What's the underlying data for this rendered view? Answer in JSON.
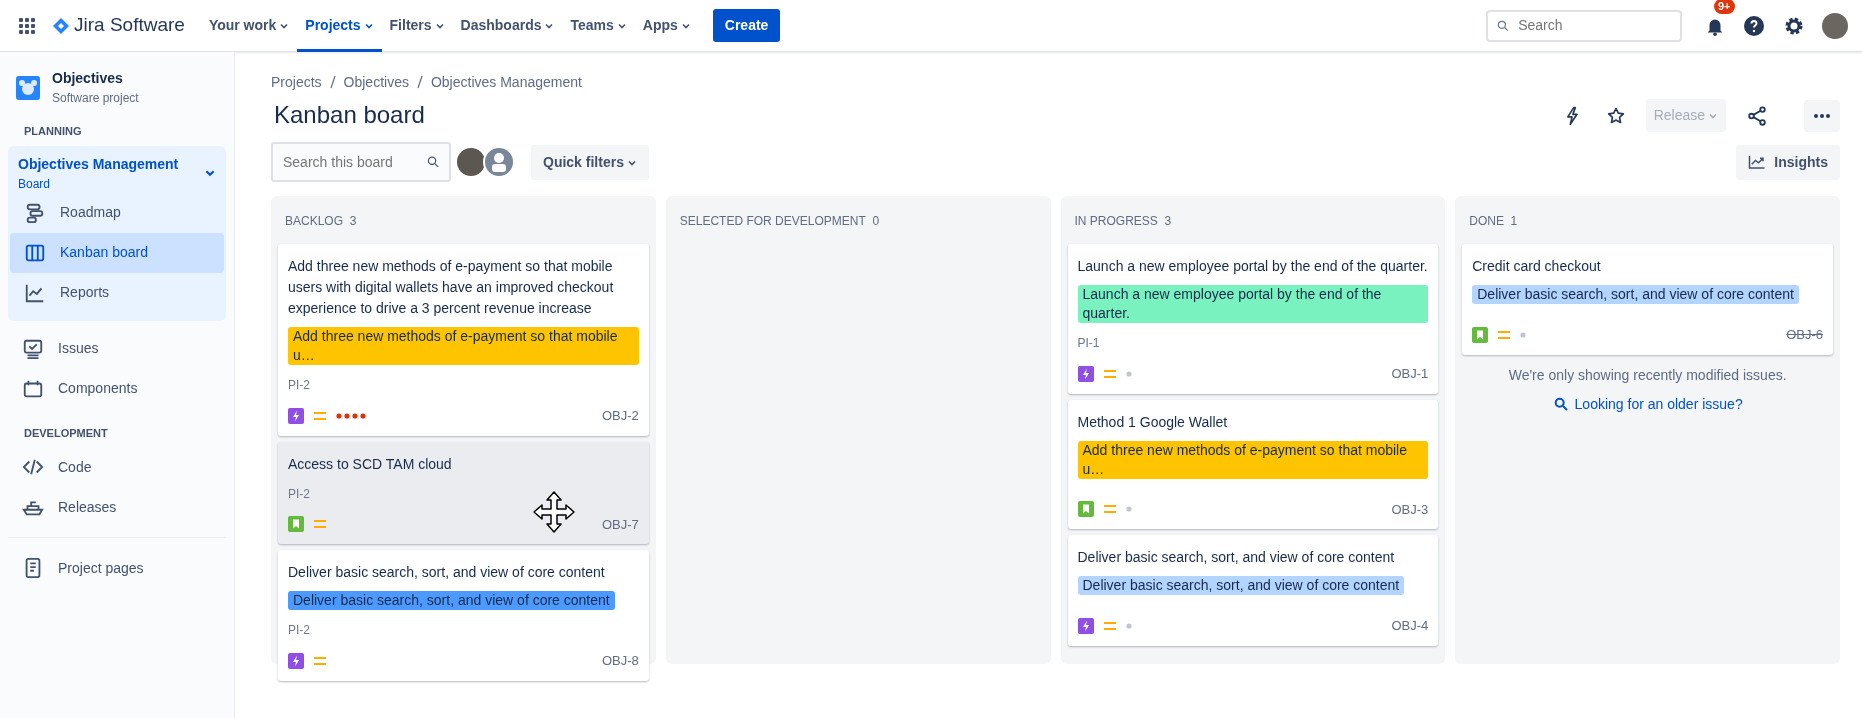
{
  "topnav": {
    "app_name": "Jira Software",
    "items": [
      {
        "label": "Your work",
        "selected": false
      },
      {
        "label": "Projects",
        "selected": true
      },
      {
        "label": "Filters",
        "selected": false
      },
      {
        "label": "Dashboards",
        "selected": false
      },
      {
        "label": "Teams",
        "selected": false
      },
      {
        "label": "Apps",
        "selected": false
      }
    ],
    "create": "Create",
    "search": {
      "placeholder": "Search"
    },
    "notifications_badge": "9+"
  },
  "sidebar": {
    "project": {
      "name": "Objectives",
      "type": "Software project"
    },
    "planning": {
      "heading": "PLANNING",
      "board": {
        "label": "Objectives Management",
        "sublabel": "Board",
        "expanded": true,
        "children": [
          {
            "label": "Roadmap",
            "selected": false
          },
          {
            "label": "Kanban board",
            "selected": true
          },
          {
            "label": "Reports",
            "selected": false
          }
        ]
      },
      "items": [
        {
          "label": "Issues",
          "selected": false
        },
        {
          "label": "Components",
          "selected": false
        }
      ]
    },
    "development": {
      "heading": "DEVELOPMENT",
      "items": [
        {
          "label": "Code",
          "selected": false
        },
        {
          "label": "Releases",
          "selected": false
        }
      ]
    },
    "footer_items": [
      {
        "label": "Project pages",
        "selected": false
      }
    ]
  },
  "page": {
    "breadcrumbs": [
      "Projects",
      "Objectives",
      "Objectives Management"
    ],
    "title": "Kanban board",
    "release_button": {
      "label": "Release",
      "disabled": true
    },
    "toolbar": {
      "search": {
        "placeholder": "Search this board"
      },
      "quick_filters": "Quick filters",
      "insights": "Insights"
    }
  },
  "columns": [
    {
      "title": "BACKLOG",
      "count": "3",
      "cards": [
        {
          "summary": "Add three new methods of e-payment so that mobile users with digital wallets have an improved checkout experience to drive a 3 percent revenue increase",
          "epic": {
            "label": "Add three new methods of e-payment so that mobile u…",
            "color": "#ffc400"
          },
          "version": "PI-2",
          "kind": "epic",
          "priority": {
            "kind": "medium"
          },
          "time_in_column": {
            "kind": "long"
          },
          "key": "OBJ-2",
          "done": false,
          "hovered": false
        },
        {
          "summary": "Access to SCD TAM cloud",
          "version": "PI-2",
          "kind": "story",
          "priority": {
            "kind": "medium"
          },
          "key": "OBJ-7",
          "done": false,
          "hovered": true
        },
        {
          "summary": "Deliver basic search, sort, and view of core content",
          "epic": {
            "label": "Deliver basic search, sort, and view of core content",
            "color": "#4c9aff"
          },
          "version": "PI-2",
          "kind": "epic",
          "priority": {
            "kind": "medium"
          },
          "key": "OBJ-8",
          "done": false,
          "hovered": false
        }
      ]
    },
    {
      "title": "SELECTED FOR DEVELOPMENT",
      "count": "0"
    },
    {
      "title": "IN PROGRESS",
      "count": "3",
      "cards": [
        {
          "summary": "Launch a new employee portal by the end of the quarter.",
          "epic": {
            "label": "Launch a new employee portal by the end of the quarter.",
            "color": "#79f2c0"
          },
          "version": "PI-1",
          "kind": "epic",
          "priority": {
            "kind": "medium"
          },
          "time_in_column": {
            "kind": "short"
          },
          "key": "OBJ-1",
          "done": false,
          "hovered": false
        },
        {
          "summary": "Method 1 Google Wallet",
          "epic": {
            "label": "Add three new methods of e-payment so that mobile u…",
            "color": "#ffc400"
          },
          "kind": "story",
          "priority": {
            "kind": "medium"
          },
          "time_in_column": {
            "kind": "short"
          },
          "key": "OBJ-3",
          "done": false,
          "hovered": false
        },
        {
          "summary": "Deliver basic search, sort, and view of core content",
          "epic": {
            "label": "Deliver basic search, sort, and view of core content",
            "color": "#b3d4ff"
          },
          "kind": "epic",
          "priority": {
            "kind": "medium"
          },
          "time_in_column": {
            "kind": "short"
          },
          "key": "OBJ-4",
          "done": false,
          "hovered": false
        }
      ]
    },
    {
      "title": "DONE",
      "count": "1",
      "cards": [
        {
          "summary": "Credit card checkout",
          "epic": {
            "label": "Deliver basic search, sort, and view of core content",
            "color": "#b3d4ff"
          },
          "kind": "story",
          "priority": {
            "kind": "medium"
          },
          "time_in_column": {
            "kind": "short"
          },
          "key": "OBJ-6",
          "done": true,
          "hovered": false
        }
      ],
      "footer": {
        "message": "We're only showing recently modified issues.",
        "link": "Looking for an older issue?"
      }
    }
  ]
}
